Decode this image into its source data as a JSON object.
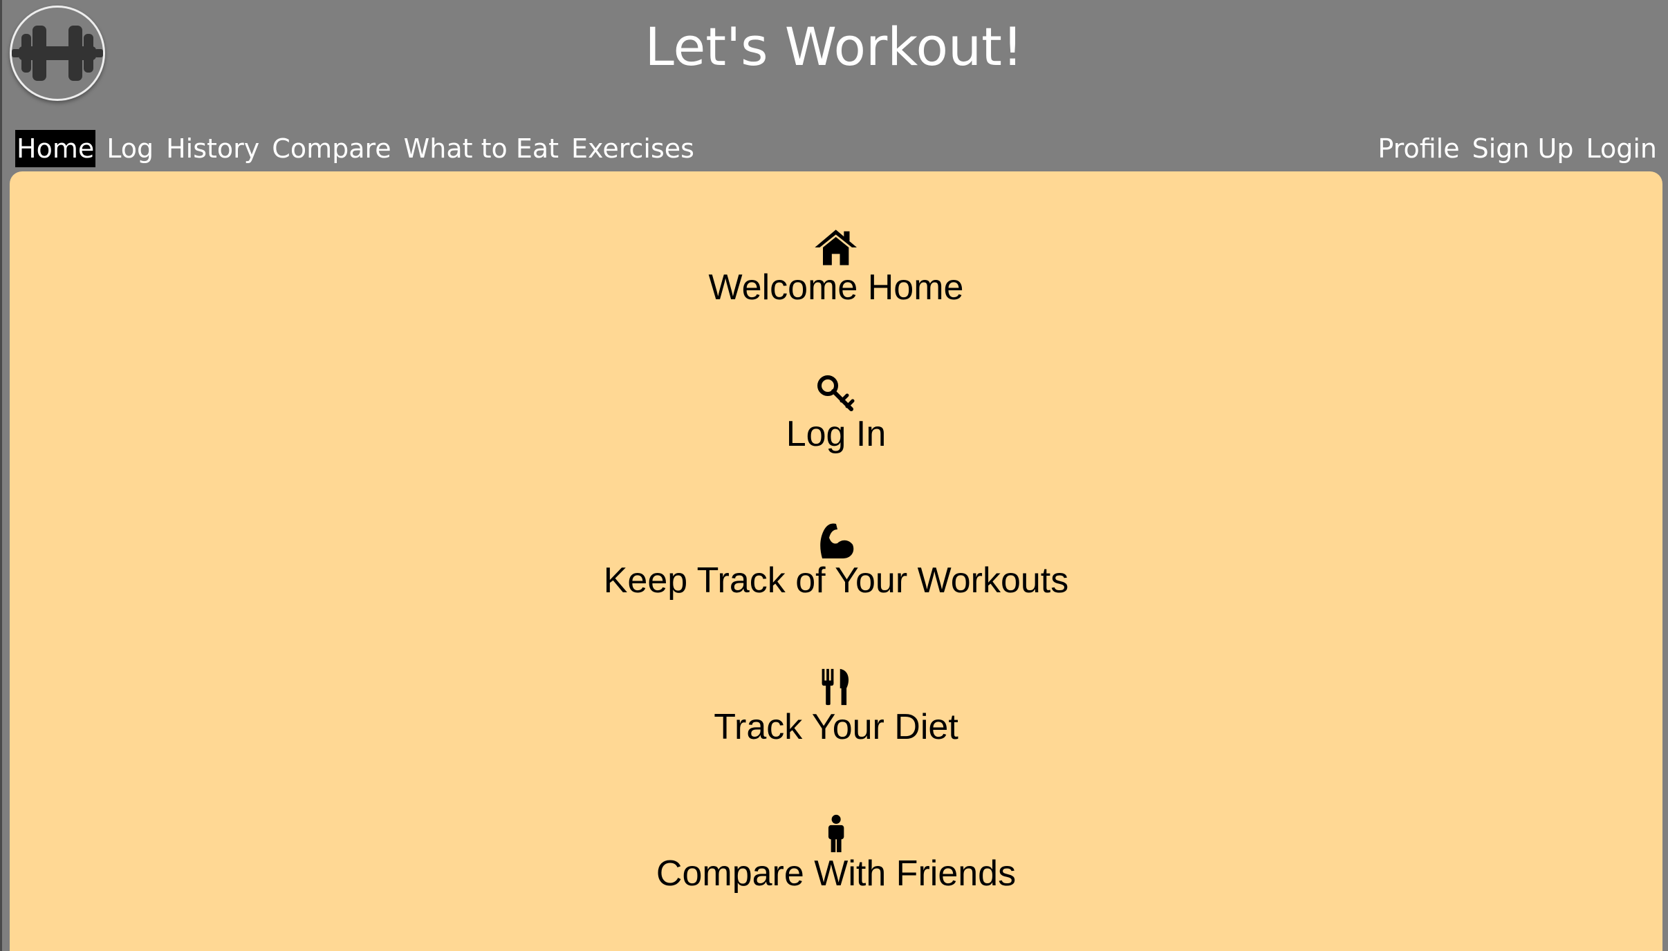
{
  "header": {
    "title": "Let's Workout!",
    "logo_icon": "dumbbell-icon"
  },
  "nav": {
    "left": [
      {
        "label": "Home",
        "active": true
      },
      {
        "label": "Log",
        "active": false
      },
      {
        "label": "History",
        "active": false
      },
      {
        "label": "Compare",
        "active": false
      },
      {
        "label": "What to Eat",
        "active": false
      },
      {
        "label": "Exercises",
        "active": false
      }
    ],
    "right": [
      {
        "label": "Profile"
      },
      {
        "label": "Sign Up"
      },
      {
        "label": "Login"
      }
    ]
  },
  "features": [
    {
      "icon": "home-icon",
      "label": "Welcome Home"
    },
    {
      "icon": "key-icon",
      "label": "Log In"
    },
    {
      "icon": "flexed-arm-icon",
      "label": "Keep Track of Your Workouts"
    },
    {
      "icon": "fork-knife-icon",
      "label": "Track Your Diet"
    },
    {
      "icon": "person-icon",
      "label": "Compare With Friends"
    }
  ],
  "colors": {
    "header_bg": "#7f7f7f",
    "panel_bg": "#ffd894",
    "active_nav_bg": "#000000",
    "nav_text": "#ffffff"
  }
}
